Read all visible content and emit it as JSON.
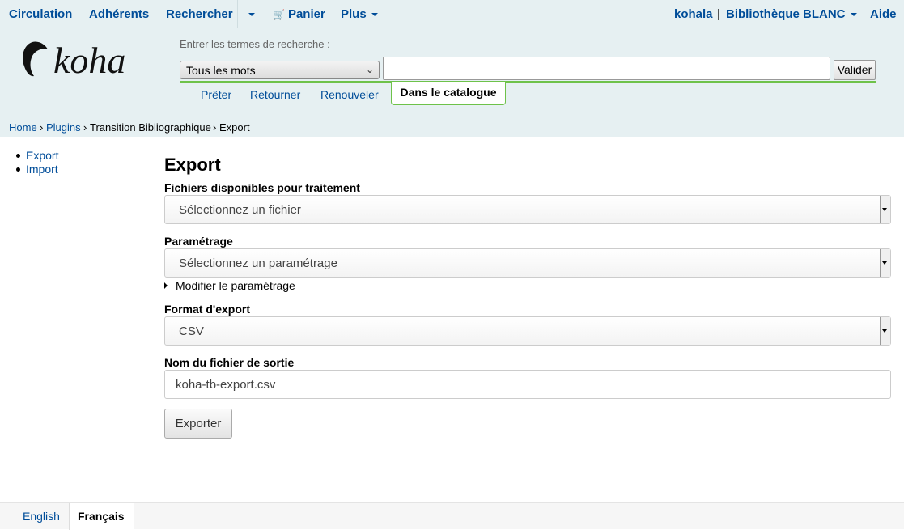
{
  "topnav": {
    "circulation": "Circulation",
    "adherents": "Adhérents",
    "rechercher": "Rechercher",
    "panier": "Panier",
    "plus": "Plus",
    "user": "kohala",
    "separator": "|",
    "library": "Bibliothèque BLANC",
    "aide": "Aide"
  },
  "header": {
    "logo_text": "koha",
    "search_hint": "Entrer les termes de recherche :",
    "search_type": "Tous les mots",
    "search_value": "",
    "search_button": "Valider",
    "tabs": [
      "Prêter",
      "Retourner",
      "Renouveler"
    ],
    "active_tab": "Dans le catalogue"
  },
  "breadcrumb": {
    "home": "Home",
    "sep1": "›",
    "plugins": "Plugins",
    "sep2": "›",
    "plugin": "Transition Bibliographique",
    "sep3": "›",
    "current": "Export"
  },
  "sidebar": {
    "items": [
      {
        "label": "Export"
      },
      {
        "label": "Import"
      }
    ]
  },
  "main": {
    "title": "Export",
    "files_label": "Fichiers disponibles pour traitement",
    "files_select": "Sélectionnez un fichier",
    "param_label": "Paramétrage",
    "param_select": "Sélectionnez un paramétrage",
    "param_toggle": "Modifier le paramétrage",
    "format_label": "Format d'export",
    "format_select": "CSV",
    "filename_label": "Nom du fichier de sortie",
    "filename_value": "koha-tb-export.csv",
    "export_button": "Exporter"
  },
  "footer": {
    "lang_english": "English",
    "lang_french": "Français"
  },
  "colors": {
    "link": "#004d99",
    "header_bg": "#e6f0f2",
    "accent_green": "#6ec24a"
  }
}
